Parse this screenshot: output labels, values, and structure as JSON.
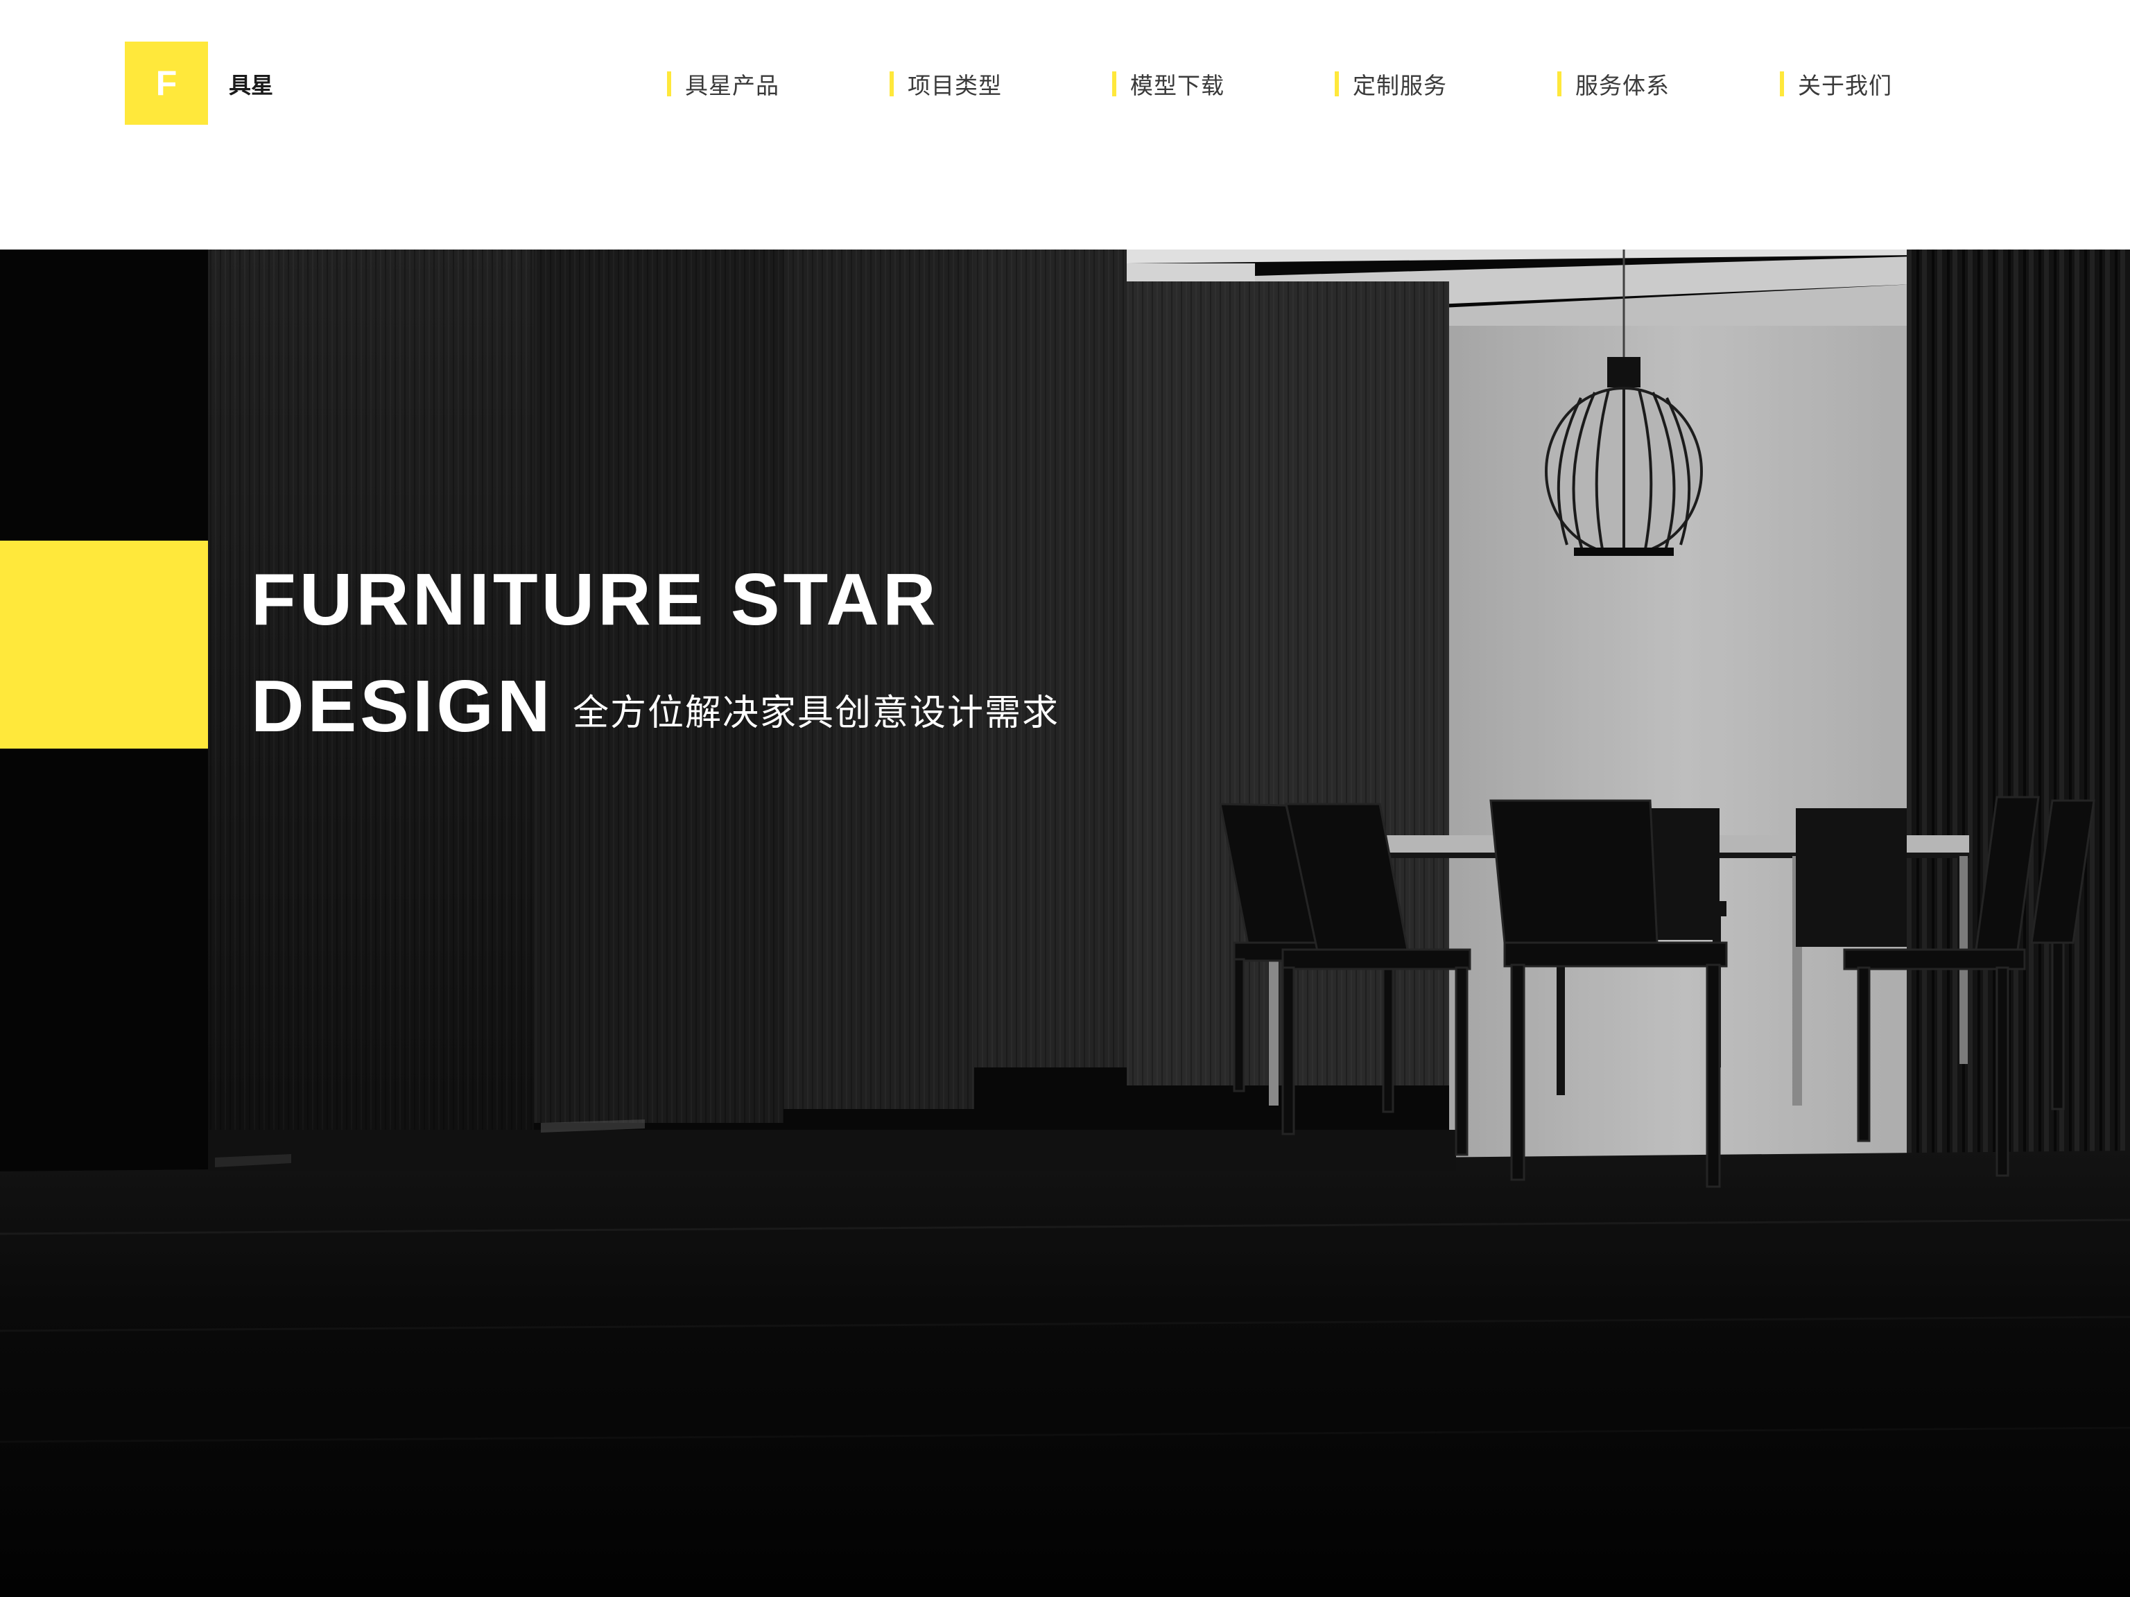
{
  "header": {
    "logo_letter": "F",
    "brand_name": "具星",
    "nav": [
      {
        "label": "具星产品"
      },
      {
        "label": "项目类型"
      },
      {
        "label": "模型下载"
      },
      {
        "label": "定制服务"
      },
      {
        "label": "服务体系"
      },
      {
        "label": "关于我们"
      }
    ]
  },
  "hero": {
    "title_line1": "FURNITURE STAR",
    "title_line2": "DESIGN",
    "subtitle": "全方位解决家具创意设计需求"
  },
  "colors": {
    "accent": "#ffe83b",
    "hero_background": "#050505",
    "nav_text": "#3a3a3a"
  }
}
